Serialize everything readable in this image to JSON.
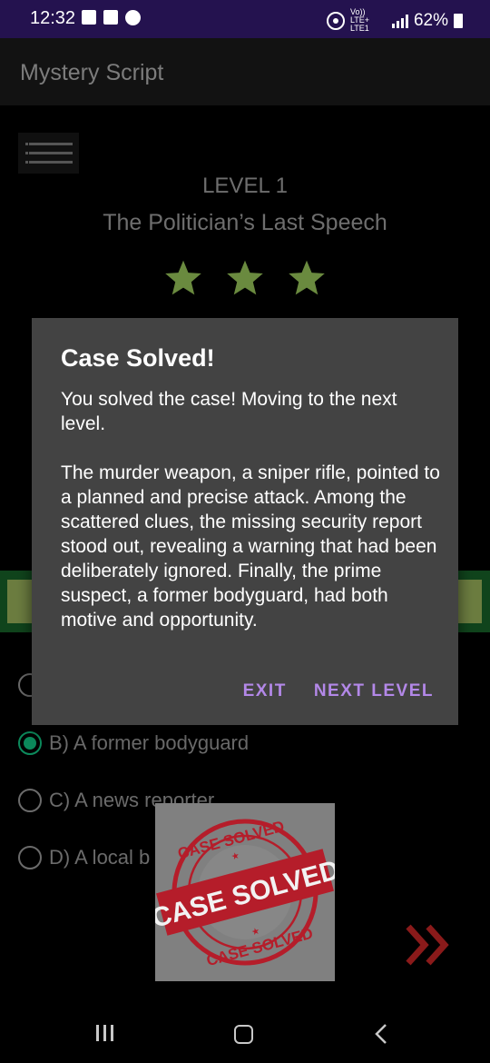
{
  "status_bar": {
    "time": "12:32",
    "network_label": "Vo)) LTE+ LTE1",
    "battery": "62%"
  },
  "app": {
    "title": "Mystery Script"
  },
  "level": {
    "label": "LEVEL 1",
    "case_title": "The Politician’s Last Speech",
    "stars": 3,
    "star_color": "#6a8a3f"
  },
  "options": [
    {
      "label": "B) A former bodyguard",
      "selected": true
    },
    {
      "label": "C) A news reporter",
      "selected": false
    },
    {
      "label": "D) A local b",
      "selected": false
    }
  ],
  "dialog": {
    "title": "Case Solved!",
    "message": "You solved the case! Moving to the next level.",
    "summary": "The murder weapon, a sniper rifle, pointed to a planned and precise attack. Among the scattered clues, the missing security report stood out, revealing a warning that had been deliberately ignored. Finally, the prime suspect, a former bodyguard, had both motive and opportunity.",
    "exit_label": "EXIT",
    "next_label": "NEXT LEVEL",
    "accent_color": "#b388e8"
  },
  "stamp": {
    "ring_text": "CASE SOLVED",
    "banner_text": "CASE SOLVED"
  },
  "icons": {
    "menu": "hamburger-icon",
    "next": "double-chevron-right-icon",
    "recent": "recent-apps-icon",
    "home": "home-icon",
    "back": "back-icon"
  }
}
